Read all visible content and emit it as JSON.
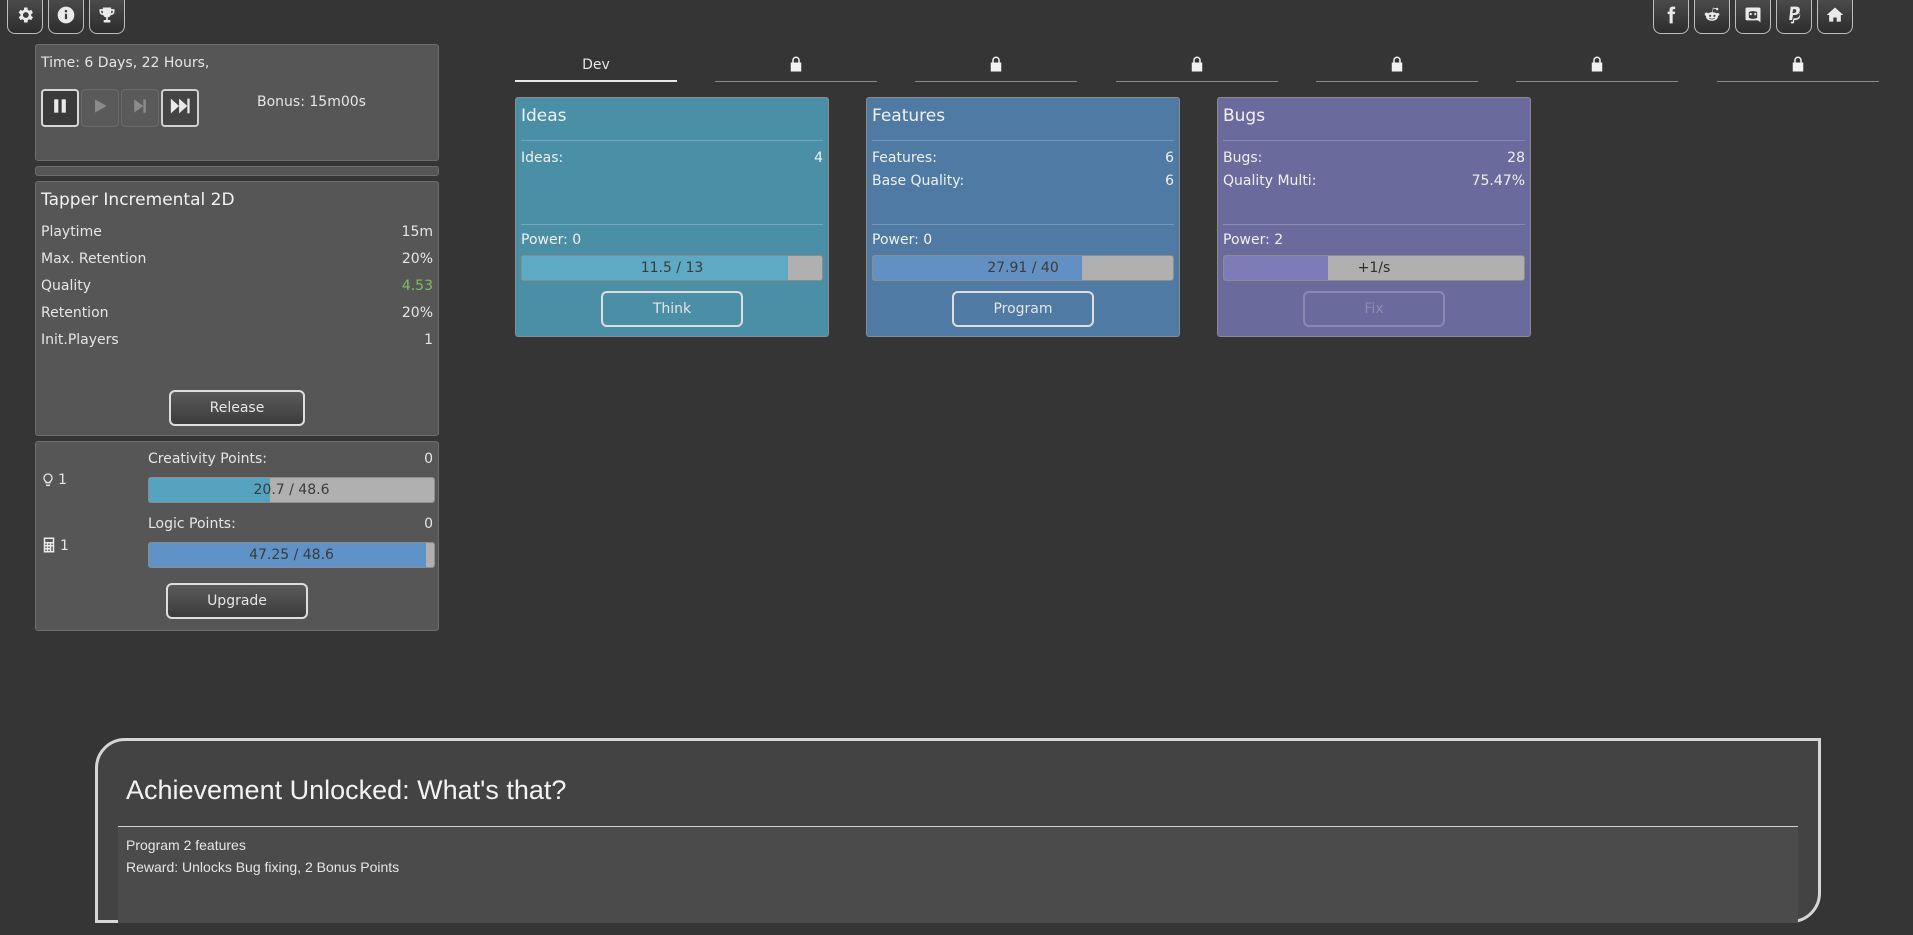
{
  "top_icons": {
    "left": [
      "gear-icon",
      "info-icon",
      "trophy-icon"
    ],
    "right": [
      "facebook-icon",
      "reddit-icon",
      "discord-icon",
      "paypal-icon",
      "home-icon"
    ]
  },
  "time_panel": {
    "time_text": "Time: 6 Days, 22 Hours,",
    "bonus_text": "Bonus: 15m00s",
    "controls": [
      "pause-icon",
      "play-icon",
      "step-forward-icon",
      "fast-forward-icon"
    ]
  },
  "game_panel": {
    "title": "Tapper Incremental 2D",
    "stats": [
      {
        "label": "Playtime",
        "value": "15m"
      },
      {
        "label": "Max. Retention",
        "value": "20%"
      },
      {
        "label": "Quality",
        "value": "4.53"
      },
      {
        "label": "Retention",
        "value": "20%"
      },
      {
        "label": "Init.Players",
        "value": "1"
      }
    ],
    "release_label": "Release",
    "quality_color": "#7fbf5f"
  },
  "points_panel": {
    "creativity": {
      "icon": "lightbulb-icon",
      "level": "1",
      "label": "Creativity Points:",
      "points": "0",
      "bar_text": "20.7 / 48.6",
      "progress": 0.426
    },
    "logic": {
      "icon": "calculator-icon",
      "level": "1",
      "label": "Logic Points:",
      "points": "0",
      "bar_text": "47.25 / 48.6",
      "progress": 0.972
    },
    "upgrade_label": "Upgrade"
  },
  "tabs": [
    {
      "label": "Dev",
      "locked": false
    },
    {
      "label": "",
      "locked": true
    },
    {
      "label": "",
      "locked": true
    },
    {
      "label": "",
      "locked": true
    },
    {
      "label": "",
      "locked": true
    },
    {
      "label": "",
      "locked": true
    },
    {
      "label": "",
      "locked": true
    }
  ],
  "cards": {
    "ideas": {
      "title": "Ideas",
      "rows": [
        {
          "label": "Ideas:",
          "value": "4"
        }
      ],
      "power": "Power: 0",
      "bar_text": "11.5 / 13",
      "progress": 0.885,
      "button": "Think",
      "color": "#4b8fa6",
      "fill_color": "#5ea9c4"
    },
    "features": {
      "title": "Features",
      "rows": [
        {
          "label": "Features:",
          "value": "6"
        },
        {
          "label": "Base Quality:",
          "value": "6"
        }
      ],
      "power": "Power: 0",
      "bar_text": "27.91 / 40",
      "progress": 0.698,
      "button": "Program",
      "color": "#4f7aa3",
      "fill_color": "#6390c2"
    },
    "bugs": {
      "title": "Bugs",
      "rows": [
        {
          "label": "Bugs:",
          "value": "28"
        },
        {
          "label": "Quality Multi:",
          "value": "75.47%"
        }
      ],
      "power": "Power: 2",
      "bar_text": "+1/s",
      "progress": 0.345,
      "button": "Fix",
      "color": "#6b6a9c",
      "fill_color": "#7e7cb8"
    }
  },
  "achievement": {
    "title": "Achievement Unlocked: What's that?",
    "line1": "Program 2 features",
    "line2": "Reward: Unlocks Bug fixing, 2 Bonus Points"
  }
}
